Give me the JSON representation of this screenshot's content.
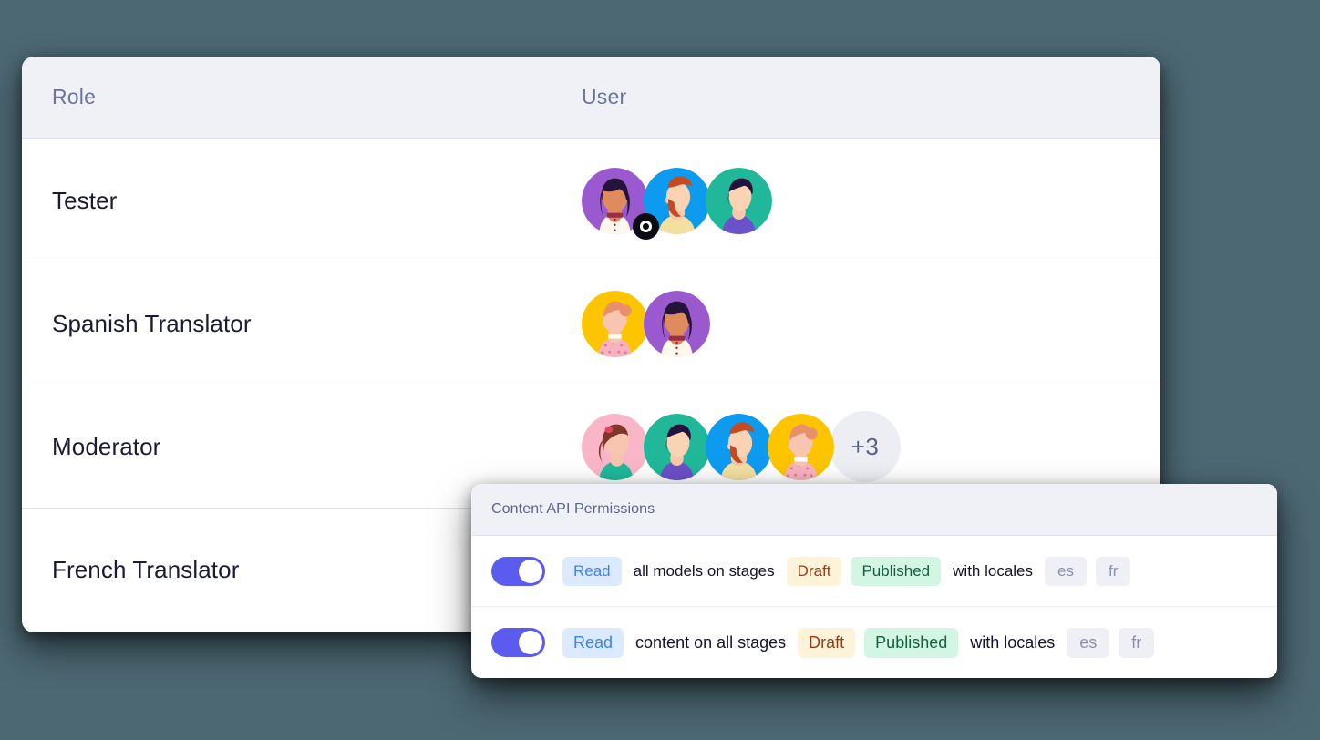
{
  "page": {
    "background_color": "#4c6873"
  },
  "roles_table": {
    "columns": [
      {
        "key": "role",
        "label": "Role"
      },
      {
        "key": "user",
        "label": "User"
      }
    ],
    "rows": [
      {
        "role": "Tester",
        "avatar_count": 3,
        "overflow_label": null,
        "avatars": [
          {
            "name": "avatar-purple-dark-hair-woman",
            "bg": "#9b59d0",
            "badge": "status-dot"
          },
          {
            "name": "avatar-blue-red-beard-man",
            "bg": "#0d9bf0",
            "badge": null
          },
          {
            "name": "avatar-teal-dark-hair-person",
            "bg": "#21b89a",
            "badge": null
          }
        ]
      },
      {
        "role": "Spanish Translator",
        "avatar_count": 2,
        "overflow_label": null,
        "avatars": [
          {
            "name": "avatar-yellow-ginger-bun-woman",
            "bg": "#fcc500",
            "badge": null
          },
          {
            "name": "avatar-purple-dark-hair-woman",
            "bg": "#9b59d0",
            "badge": null
          }
        ]
      },
      {
        "role": "Moderator",
        "avatar_count": 4,
        "overflow_label": "+3",
        "avatars": [
          {
            "name": "avatar-pink-brown-hair-woman",
            "bg": "#f9b6c8",
            "badge": null
          },
          {
            "name": "avatar-teal-dark-hair-person",
            "bg": "#21b89a",
            "badge": null
          },
          {
            "name": "avatar-blue-red-beard-man",
            "bg": "#0d9bf0",
            "badge": null
          },
          {
            "name": "avatar-yellow-ginger-bun-woman",
            "bg": "#fcc500",
            "badge": null
          }
        ]
      },
      {
        "role": "French Translator",
        "avatar_count": 0,
        "overflow_label": null,
        "avatars": []
      }
    ]
  },
  "permissions_popup": {
    "title": "Content API Permissions",
    "rows": [
      {
        "toggle_on": true,
        "action": "Read",
        "scope": "all models on stages",
        "stages": [
          "Draft",
          "Published"
        ],
        "locales_label": "with locales",
        "locales": [
          "es",
          "fr"
        ]
      },
      {
        "toggle_on": true,
        "action": "Read",
        "scope": "content on all stages",
        "stages": [
          "Draft",
          "Published"
        ],
        "locales_label": "with locales",
        "locales": [
          "es",
          "fr"
        ]
      }
    ]
  },
  "colors": {
    "toggle_on": "#5b5bf0",
    "chip_read_bg": "#dbeafe",
    "chip_read_text": "#3b82f6",
    "chip_draft_bg": "#fdf3d8",
    "chip_draft_text": "#9a3d16",
    "chip_published_bg": "#d3f5e3",
    "chip_published_text": "#14613f",
    "chip_locale_bg": "#eef0f6",
    "chip_locale_text": "#8a91ad",
    "header_bg": "#f0f1f7",
    "header_text": "#6b749b",
    "row_text": "#1b1b33",
    "divider": "#dfe2ee"
  }
}
